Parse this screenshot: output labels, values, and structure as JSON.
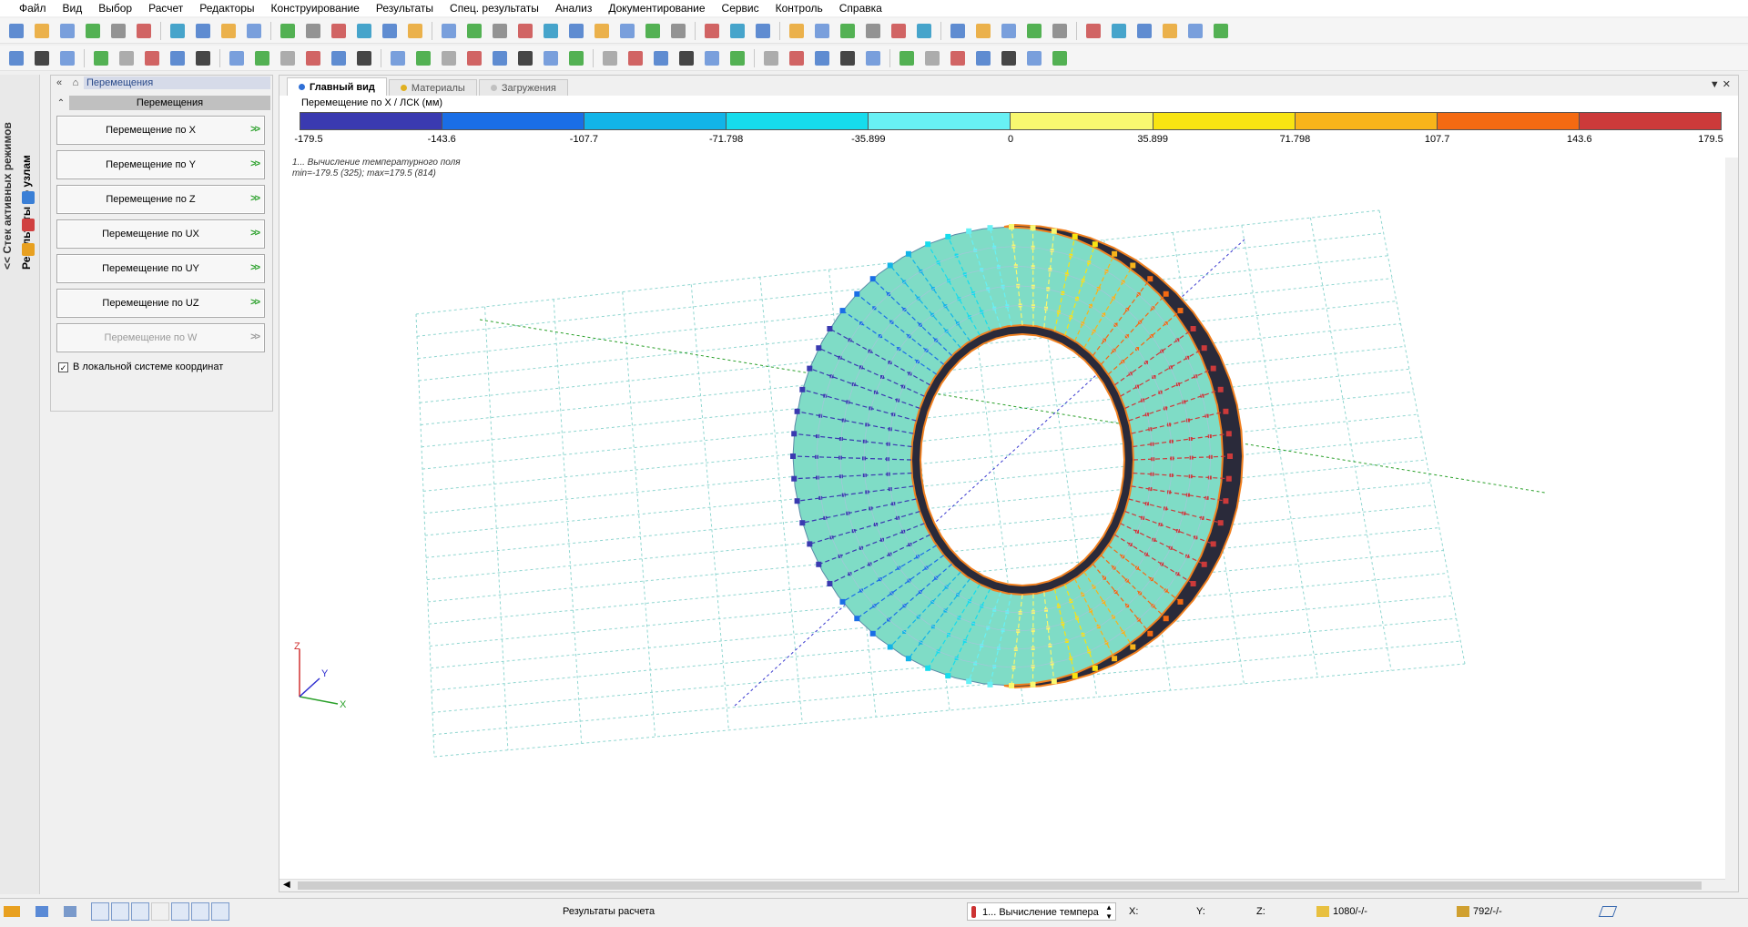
{
  "menu": [
    "Файл",
    "Вид",
    "Выбор",
    "Расчет",
    "Редакторы",
    "Конструирование",
    "Результаты",
    "Спец. результаты",
    "Анализ",
    "Документирование",
    "Сервис",
    "Контроль",
    "Справка"
  ],
  "left_tabs": {
    "stack": "<< Стек активных режимов",
    "node_results": "Результаты по узлам"
  },
  "panel": {
    "title": "Перемещения",
    "section": "Перемещения",
    "buttons": [
      {
        "label": "Перемещение по X",
        "enabled": true
      },
      {
        "label": "Перемещение по Y",
        "enabled": true
      },
      {
        "label": "Перемещение по Z",
        "enabled": true
      },
      {
        "label": "Перемещение по UX",
        "enabled": true
      },
      {
        "label": "Перемещение по UY",
        "enabled": true
      },
      {
        "label": "Перемещение по UZ",
        "enabled": true
      },
      {
        "label": "Перемещение по W",
        "enabled": false
      }
    ],
    "arrow": ">>",
    "checkbox_label": "В локальной системе координат",
    "checkbox_checked": true
  },
  "viewport": {
    "tabs": [
      {
        "label": "Главный вид",
        "active": true,
        "dot": "#2f6fd6"
      },
      {
        "label": "Материалы",
        "active": false,
        "dot": "#e0b020"
      },
      {
        "label": "Загружения",
        "active": false,
        "dot": "#c0c0c0"
      }
    ],
    "legend_title": "Перемещение по X / ЛСК (мм)",
    "legend_colors": [
      "#3a3ab0",
      "#1a6ee6",
      "#12b4e8",
      "#16dcec",
      "#68f0f4",
      "#f8f870",
      "#f8e412",
      "#f8b41a",
      "#f46a12",
      "#cc3a3a"
    ],
    "legend_values": [
      "-179.5",
      "-143.6",
      "-107.7",
      "-71.798",
      "-35.899",
      "0",
      "35.899",
      "71.798",
      "107.7",
      "143.6",
      "179.5"
    ],
    "info_line1": "1... Вычисление температурного поля",
    "info_line2": "min=-179.5 (325); max=179.5 (814)",
    "axes": {
      "x": "X",
      "y": "Y",
      "z": "Z"
    }
  },
  "status": {
    "mode": "Результаты расчета",
    "load": "1... Вычисление темпера",
    "x_label": "X:",
    "y_label": "Y:",
    "z_label": "Z:",
    "nodes": "1080/-/-",
    "elements": "792/-/-"
  }
}
